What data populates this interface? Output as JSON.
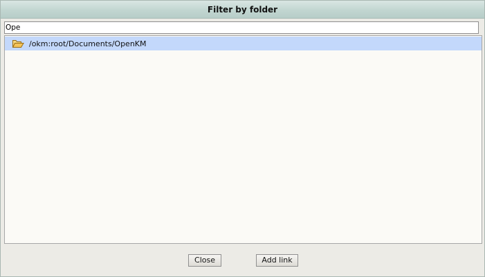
{
  "dialog": {
    "title": "Filter by folder"
  },
  "filter": {
    "value": "Ope",
    "placeholder": ""
  },
  "results": {
    "items": [
      {
        "path": "/okm:root/Documents/OpenKM",
        "icon": "folder-open-icon",
        "selected": true
      }
    ]
  },
  "buttons": {
    "close_label": "Close",
    "add_link_label": "Add link"
  },
  "colors": {
    "selected_row": "#c3d8fb",
    "title_bar": "#c2d6d1",
    "dialog_background": "#ecebe6",
    "folder_icon": "#f3c35a"
  }
}
